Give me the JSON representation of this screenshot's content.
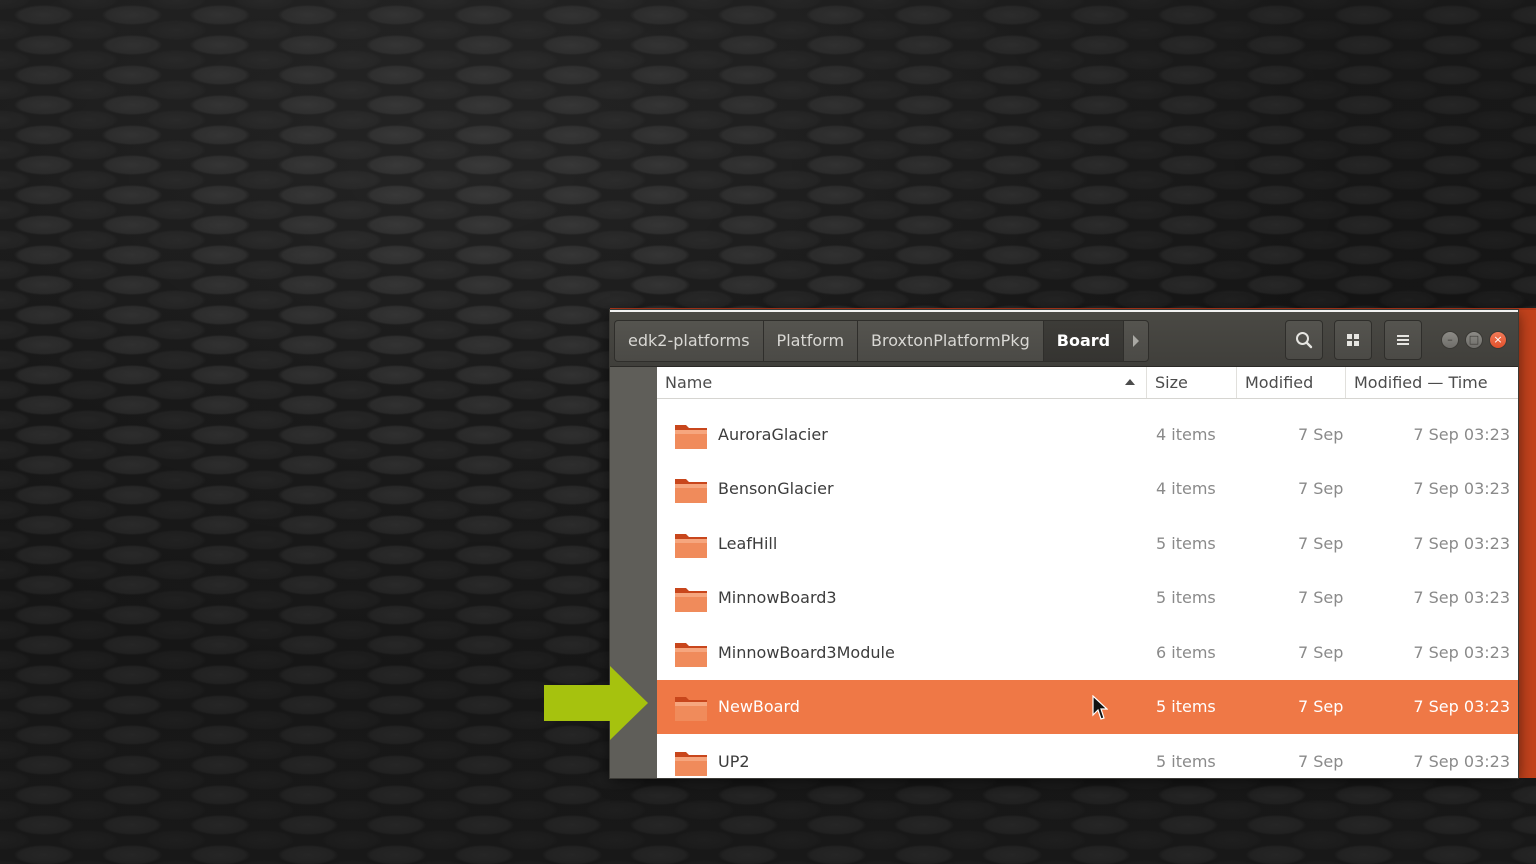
{
  "path_bar": {
    "crumbs": [
      "edk2-platforms",
      "Platform",
      "BroxtonPlatformPkg",
      "Board"
    ]
  },
  "header_buttons": {
    "search_icon": "search-icon",
    "view_icon": "grid-view-icon",
    "menu_icon": "hamburger-menu-icon"
  },
  "columns": {
    "name": "Name",
    "size": "Size",
    "modified": "Modified",
    "modified_time": "Modified — Time"
  },
  "rows": [
    {
      "name": "AuroraGlacier",
      "size": "4 items",
      "modified": "7 Sep",
      "time": "7 Sep 03:23"
    },
    {
      "name": "BensonGlacier",
      "size": "4 items",
      "modified": "7 Sep",
      "time": "7 Sep 03:23"
    },
    {
      "name": "LeafHill",
      "size": "5 items",
      "modified": "7 Sep",
      "time": "7 Sep 03:23"
    },
    {
      "name": "MinnowBoard3",
      "size": "5 items",
      "modified": "7 Sep",
      "time": "7 Sep 03:23"
    },
    {
      "name": "MinnowBoard3Module",
      "size": "6 items",
      "modified": "7 Sep",
      "time": "7 Sep 03:23"
    },
    {
      "name": "NewBoard",
      "size": "5 items",
      "modified": "7 Sep",
      "time": "7 Sep 03:23",
      "selected": true
    },
    {
      "name": "UP2",
      "size": "5 items",
      "modified": "7 Sep",
      "time": "7 Sep 03:23"
    }
  ],
  "colors": {
    "selection": "#ef7846",
    "accent": "#c2421c",
    "pointer_arrow": "#a6c20e",
    "folder": "#e95e2a"
  }
}
